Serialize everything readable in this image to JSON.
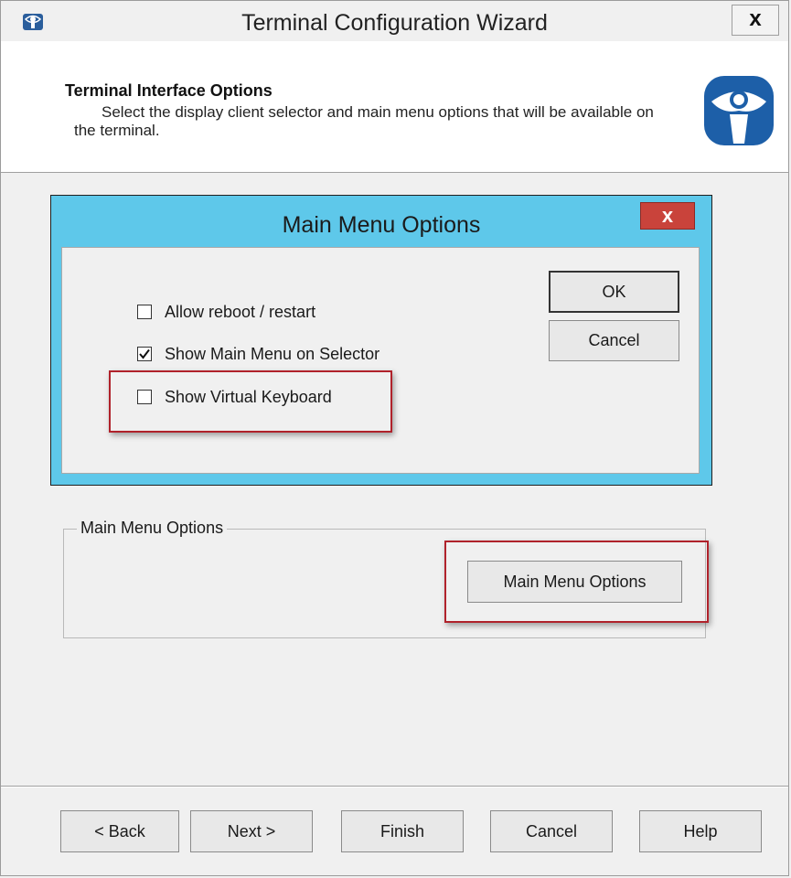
{
  "window": {
    "title": "Terminal Configuration Wizard",
    "close_label": "x",
    "title_icon": "thinmanager-app-icon"
  },
  "header": {
    "title": "Terminal Interface Options",
    "description": "Select the display client selector and main menu options that will be available on the terminal.",
    "logo": "thinmanager-logo"
  },
  "dialog": {
    "title": "Main Menu Options",
    "close_label": "x",
    "options": [
      {
        "label": "Allow reboot / restart",
        "checked": false
      },
      {
        "label": "Show Main Menu on Selector",
        "checked": true
      },
      {
        "label": "Show Virtual Keyboard",
        "checked": false
      }
    ],
    "ok_label": "OK",
    "cancel_label": "Cancel"
  },
  "group": {
    "legend": "Main Menu Options",
    "button_label": "Main Menu Options"
  },
  "footer": {
    "back_label": "< Back",
    "next_label": "Next >",
    "finish_label": "Finish",
    "cancel_label": "Cancel",
    "help_label": "Help"
  },
  "colors": {
    "dialog_frame": "#5ec8ea",
    "dialog_close": "#c9433b",
    "highlight": "#b0222b",
    "logo_blue": "#1d5fa8"
  }
}
